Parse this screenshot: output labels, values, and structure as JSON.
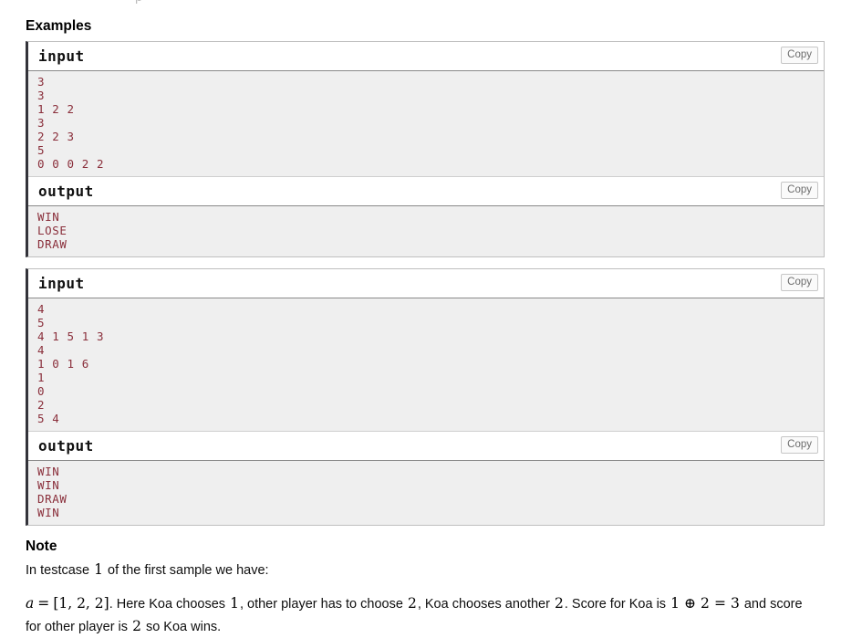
{
  "top_clipped_text": "p",
  "examples": {
    "heading": "Examples",
    "copy_label": "Copy",
    "tests": [
      {
        "input_label": "input",
        "input_text": "3\n3\n1 2 2\n3\n2 2 3\n5\n0 0 0 2 2",
        "output_label": "output",
        "output_text": "WIN\nLOSE\nDRAW"
      },
      {
        "input_label": "input",
        "input_text": "4\n5\n4 1 5 1 3\n4\n1 0 1 6\n1\n0\n2\n5 4",
        "output_label": "output",
        "output_text": "WIN\nWIN\nDRAW\nWIN"
      }
    ]
  },
  "note": {
    "heading": "Note",
    "intro_before": "In testcase ",
    "intro_num": "1",
    "intro_after": " of the first sample we have:",
    "para": {
      "var_a": "a",
      "equals": "=",
      "array": "[1, 2, 2]",
      "t1": ". Here Koa chooses ",
      "n1": "1",
      "t2": ", other player has to choose ",
      "n2": "2",
      "t3": ", Koa chooses another ",
      "n3": "2",
      "t4": ". Score for Koa is ",
      "expr_a": "1",
      "expr_op": "⊕",
      "expr_b": "2",
      "expr_eq": "=",
      "expr_c": "3",
      "t5": " and score for other player is ",
      "n4": "2",
      "t6": " so Koa wins."
    }
  },
  "colors": {
    "code_text": "#8a2f3b",
    "code_bg": "#efefef",
    "block_border": "#bfbfbf",
    "block_accent": "#33333a"
  }
}
